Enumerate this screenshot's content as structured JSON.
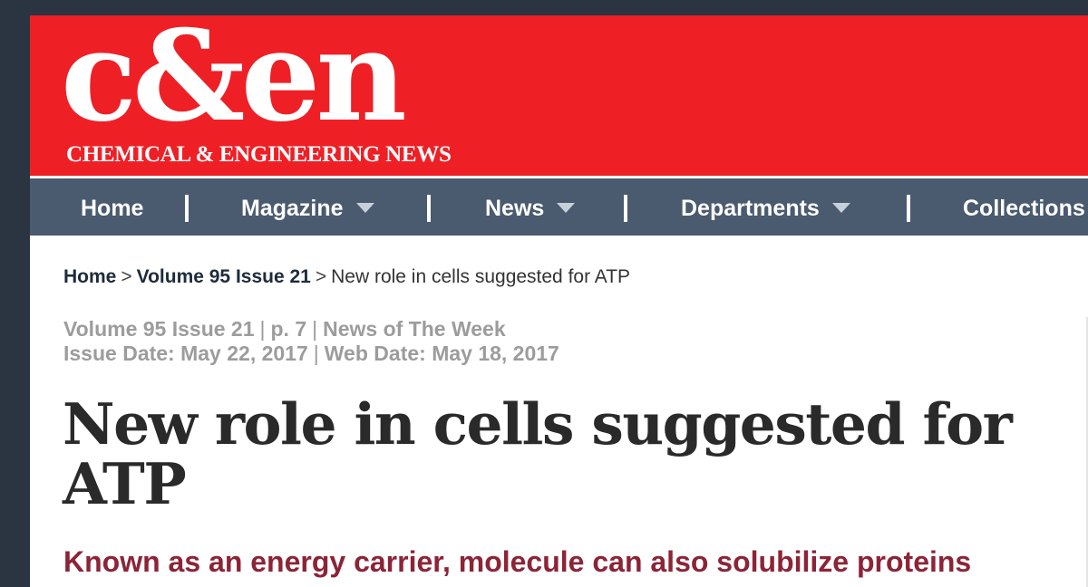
{
  "brand": {
    "logo_mark": "c&en",
    "tagline": "CHEMICAL & ENGINEERING NEWS",
    "masthead_color": "#ee2026",
    "nav_color": "#4a5a6f"
  },
  "nav": {
    "items": [
      {
        "label": "Home",
        "has_dropdown": false
      },
      {
        "label": "Magazine",
        "has_dropdown": true
      },
      {
        "label": "News",
        "has_dropdown": true
      },
      {
        "label": "Departments",
        "has_dropdown": true
      },
      {
        "label": "Collections",
        "has_dropdown": false
      }
    ]
  },
  "breadcrumb": {
    "home": "Home",
    "issue": "Volume 95 Issue 21",
    "separator": ">",
    "current": "New role in cells suggested for ATP"
  },
  "meta": {
    "volume": "Volume 95 Issue 21",
    "page": "p. 7",
    "section": "News of The Week",
    "issue_date": "Issue Date: May 22, 2017",
    "web_date": "Web Date: May 18, 2017",
    "pipe": "|"
  },
  "article": {
    "headline": "New role in cells suggested for ATP",
    "deck": "Known as an energy carrier, molecule can also solubilize proteins",
    "deck_color": "#8c2437"
  }
}
